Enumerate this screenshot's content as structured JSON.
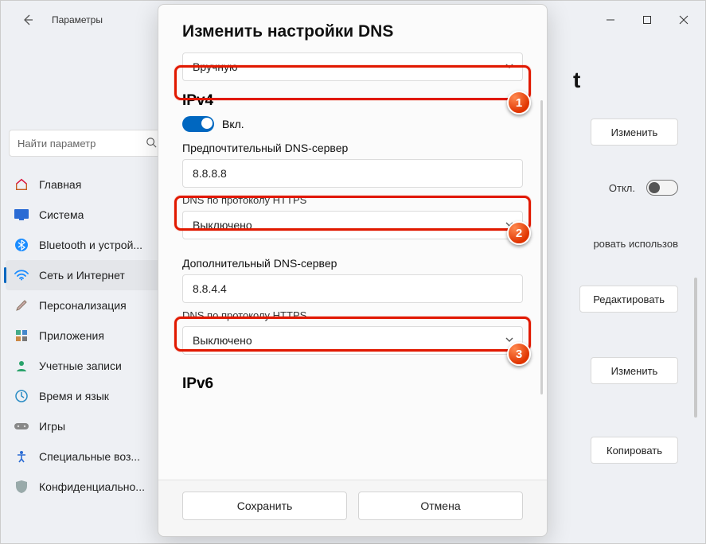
{
  "titlebar": {
    "app_title": "Параметры"
  },
  "search": {
    "placeholder": "Найти параметр"
  },
  "sidebar": {
    "items": [
      {
        "label": "Главная"
      },
      {
        "label": "Система"
      },
      {
        "label": "Bluetooth и устрой..."
      },
      {
        "label": "Сеть и Интернет"
      },
      {
        "label": "Персонализация"
      },
      {
        "label": "Приложения"
      },
      {
        "label": "Учетные записи"
      },
      {
        "label": "Время и язык"
      },
      {
        "label": "Игры"
      },
      {
        "label": "Специальные воз..."
      },
      {
        "label": "Конфиденциально..."
      }
    ]
  },
  "background": {
    "page_title_suffix": "t",
    "btn_change": "Изменить",
    "off_label": "Откл.",
    "use_label": "ровать использов",
    "btn_edit": "Редактировать",
    "btn_change2": "Изменить",
    "btn_copy": "Копировать"
  },
  "dialog": {
    "title": "Изменить настройки DNS",
    "mode_value": "Вручную",
    "ipv4_title": "IPv4",
    "ipv4_on_label": "Вкл.",
    "preferred_label": "Предпочтительный DNS-сервер",
    "preferred_value": "8.8.8.8",
    "doh_label": "DNS по протоколу HTTPS",
    "doh_value": "Выключено",
    "alternate_label": "Дополнительный DNS-сервер",
    "alternate_value": "8.8.4.4",
    "doh2_label": "DNS по протоколу HTTPS",
    "doh2_value": "Выключено",
    "ipv6_title": "IPv6",
    "save": "Сохранить",
    "cancel": "Отмена"
  },
  "annotations": {
    "b1": "1",
    "b2": "2",
    "b3": "3"
  }
}
